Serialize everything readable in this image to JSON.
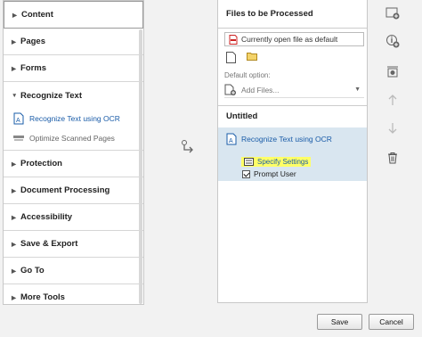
{
  "left_panel": {
    "categories": [
      {
        "label": "Content"
      },
      {
        "label": "Pages"
      },
      {
        "label": "Forms"
      },
      {
        "label": "Recognize Text"
      },
      {
        "label": "Protection"
      },
      {
        "label": "Document Processing"
      },
      {
        "label": "Accessibility"
      },
      {
        "label": "Save & Export"
      },
      {
        "label": "Go To"
      },
      {
        "label": "More Tools"
      }
    ],
    "recognize_subtools": [
      {
        "label": "Recognize Text using OCR"
      },
      {
        "label": "Optimize Scanned Pages"
      }
    ]
  },
  "right_panel": {
    "files_header": "Files to be Processed",
    "current_file": "Currently open file as default",
    "default_option_label": "Default option:",
    "add_files": "Add Files...",
    "untitled_header": "Untitled",
    "action_title": "Recognize Text using OCR",
    "specify_settings": "Specify Settings",
    "prompt_user": "Prompt User"
  },
  "buttons": {
    "save": "Save",
    "cancel": "Cancel"
  },
  "colors": {
    "accent_blue": "#1a5ca8",
    "highlight_yellow": "#ffff66",
    "selected_block": "#d9e6f0"
  }
}
